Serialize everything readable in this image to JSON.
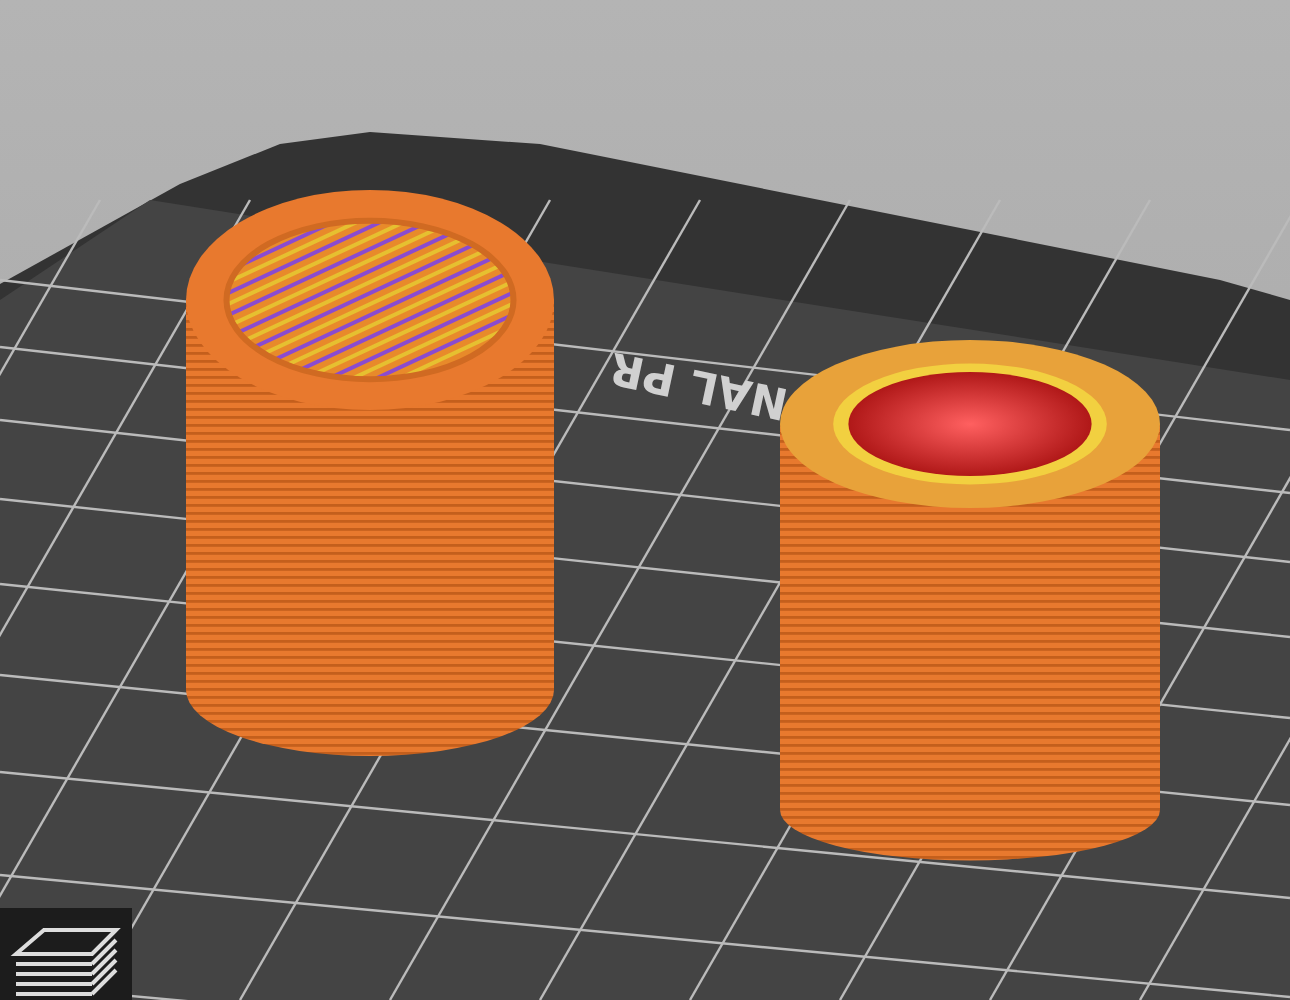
{
  "viewport": {
    "bed_label": "NAL PR",
    "objects": [
      {
        "kind": "solid"
      },
      {
        "kind": "hollow"
      }
    ]
  },
  "toolbar": {
    "layers_button": {
      "selected": false
    }
  }
}
